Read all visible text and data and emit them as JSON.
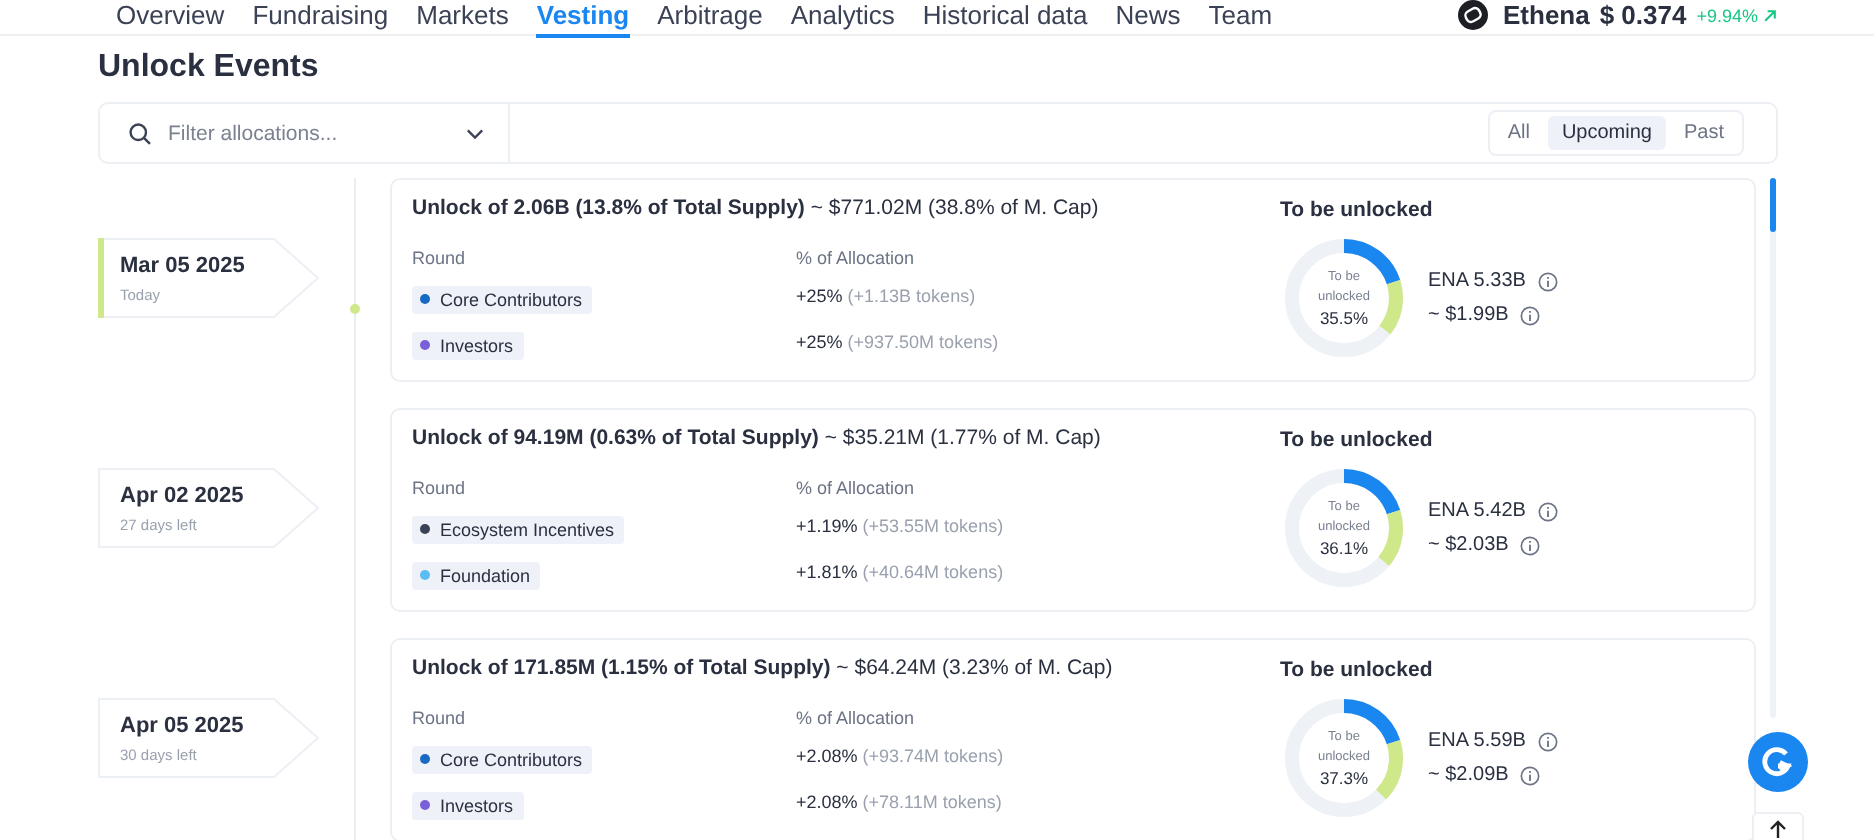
{
  "nav": {
    "tabs": [
      {
        "label": "Overview",
        "selected": false
      },
      {
        "label": "Fundraising",
        "selected": false
      },
      {
        "label": "Markets",
        "selected": false
      },
      {
        "label": "Vesting",
        "selected": true
      },
      {
        "label": "Arbitrage",
        "selected": false
      },
      {
        "label": "Analytics",
        "selected": false
      },
      {
        "label": "Historical data",
        "selected": false
      },
      {
        "label": "News",
        "selected": false
      },
      {
        "label": "Team",
        "selected": false
      }
    ],
    "coin": {
      "name": "Ethena",
      "price": "$ 0.374",
      "change": "+9.94%"
    }
  },
  "title": "Unlock Events",
  "filter": {
    "placeholder": "Filter allocations...",
    "periods": [
      {
        "label": "All",
        "selected": false
      },
      {
        "label": "Upcoming",
        "selected": true
      },
      {
        "label": "Past",
        "selected": false
      }
    ]
  },
  "events": [
    {
      "date": "Mar 05 2025",
      "note": "Today",
      "current": true,
      "headline_bold": "Unlock of 2.06B (13.8% of Total Supply)",
      "headline_rest": "~ $771.02M (38.8% of M. Cap)",
      "round_header": "Round",
      "alloc_header": "% of Allocation",
      "rounds": [
        {
          "name": "Core Contributors",
          "color": "#1769c4",
          "share": "+25%",
          "tokens": "(+1.13B tokens)"
        },
        {
          "name": "Investors",
          "color": "#7b5fd8",
          "share": "+25%",
          "tokens": "(+937.50M tokens)"
        }
      ],
      "side_title": "To be unlocked",
      "donut": {
        "caption": "To be unlocked",
        "percent": "35.5%",
        "segments": [
          {
            "kind": "unlocked",
            "level": 0.2
          },
          {
            "kind": "next",
            "level": 0.155
          }
        ]
      },
      "amount": "ENA 5.33B",
      "value": "~ $1.99B"
    },
    {
      "date": "Apr 02 2025",
      "note": "27 days left",
      "current": false,
      "headline_bold": "Unlock of 94.19M (0.63% of Total Supply)",
      "headline_rest": "~ $35.21M (1.77% of M. Cap)",
      "round_header": "Round",
      "alloc_header": "% of Allocation",
      "rounds": [
        {
          "name": "Ecosystem Incentives",
          "color": "#3b4256",
          "share": "+1.19%",
          "tokens": "(+53.55M tokens)"
        },
        {
          "name": "Foundation",
          "color": "#5bbcf2",
          "share": "+1.81%",
          "tokens": "(+40.64M tokens)"
        }
      ],
      "side_title": "To be unlocked",
      "donut": {
        "caption": "To be unlocked",
        "percent": "36.1%",
        "segments": [
          {
            "kind": "unlocked",
            "level": 0.2
          },
          {
            "kind": "next",
            "level": 0.161
          }
        ]
      },
      "amount": "ENA 5.42B",
      "value": "~ $2.03B"
    },
    {
      "date": "Apr 05 2025",
      "note": "30 days left",
      "current": false,
      "headline_bold": "Unlock of 171.85M (1.15% of Total Supply)",
      "headline_rest": "~ $64.24M (3.23% of M. Cap)",
      "round_header": "Round",
      "alloc_header": "% of Allocation",
      "rounds": [
        {
          "name": "Core Contributors",
          "color": "#1769c4",
          "share": "+2.08%",
          "tokens": "(+93.74M tokens)"
        },
        {
          "name": "Investors",
          "color": "#7b5fd8",
          "share": "+2.08%",
          "tokens": "(+78.11M tokens)"
        }
      ],
      "side_title": "To be unlocked",
      "donut": {
        "caption": "To be unlocked",
        "percent": "37.3%",
        "segments": [
          {
            "kind": "unlocked",
            "level": 0.2
          },
          {
            "kind": "next",
            "level": 0.173
          }
        ]
      },
      "amount": "ENA 5.59B",
      "value": "~ $2.09B"
    }
  ]
}
